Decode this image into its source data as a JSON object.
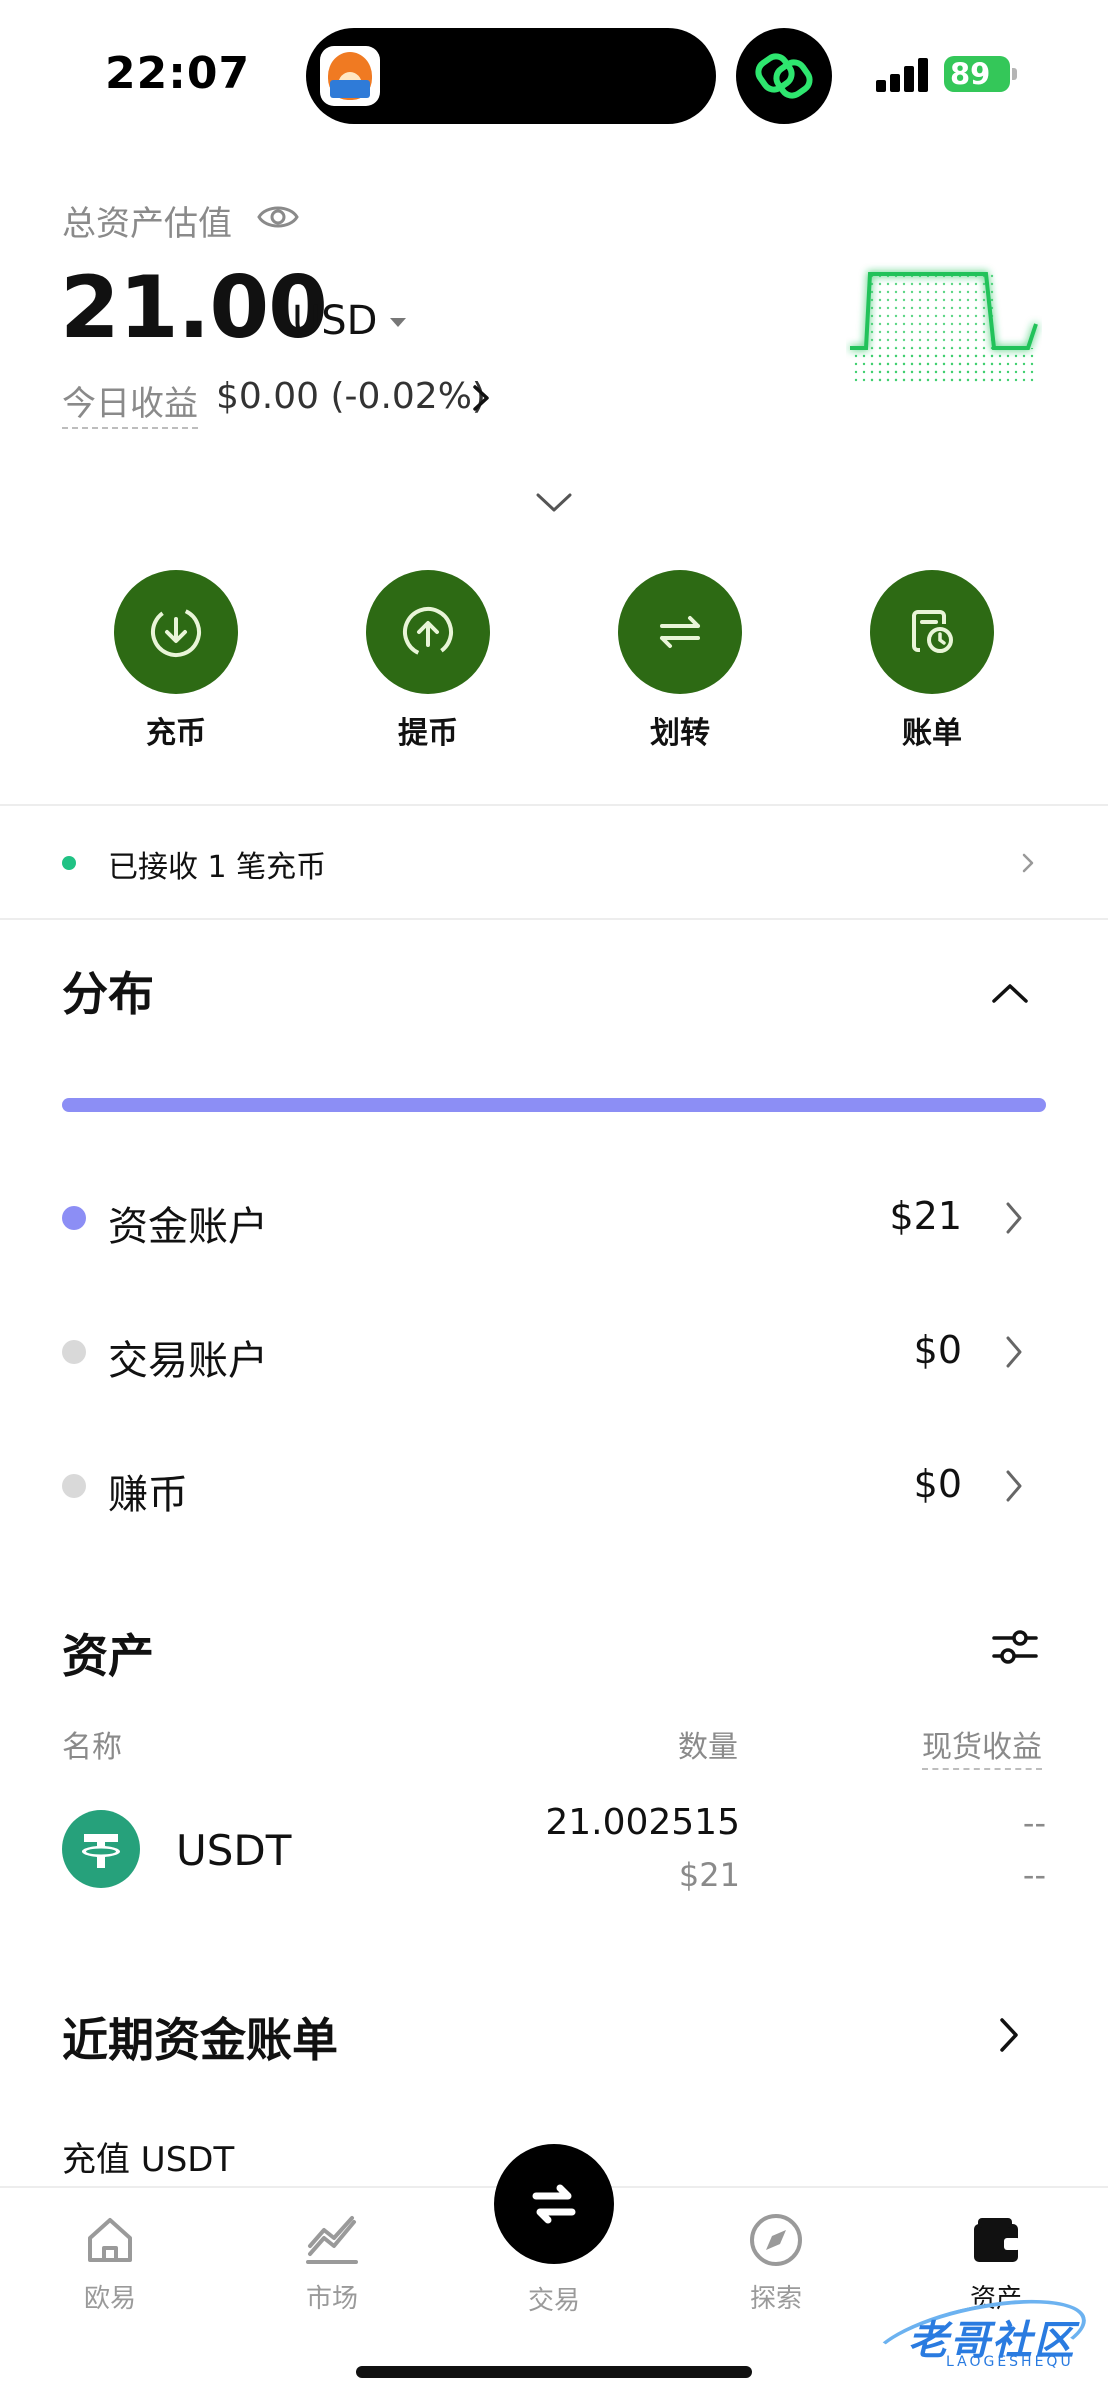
{
  "status_bar": {
    "time": "22:07",
    "battery": "89"
  },
  "header": {
    "total_label": "总资产估值",
    "total_value": "21.00",
    "currency": "USD",
    "today_label": "今日收益",
    "today_value": "$0.00 (-0.02%)"
  },
  "actions": [
    {
      "label": "充币",
      "icon": "deposit-icon"
    },
    {
      "label": "提币",
      "icon": "withdraw-icon"
    },
    {
      "label": "划转",
      "icon": "transfer-icon"
    },
    {
      "label": "账单",
      "icon": "bill-icon"
    }
  ],
  "notice": {
    "text": "已接收 1 笔充币"
  },
  "distribution": {
    "title": "分布",
    "accounts": [
      {
        "name": "资金账户",
        "value": "$21",
        "color": "#8c8ef5"
      },
      {
        "name": "交易账户",
        "value": "$0",
        "color": "#d9d9d9"
      },
      {
        "name": "赚币",
        "value": "$0",
        "color": "#d9d9d9"
      }
    ]
  },
  "assets": {
    "title": "资产",
    "columns": {
      "name": "名称",
      "qty": "数量",
      "spot_pnl": "现货收益"
    },
    "rows": [
      {
        "symbol": "USDT",
        "qty": "21.002515",
        "usd": "$21",
        "pnl": "--",
        "pnl_pct": "--"
      }
    ]
  },
  "recent": {
    "title": "近期资金账单",
    "first_item": "充值 USDT"
  },
  "tabbar": {
    "tabs": [
      {
        "label": "欧易",
        "icon": "home-icon"
      },
      {
        "label": "市场",
        "icon": "market-chart-icon"
      },
      {
        "label": "交易",
        "icon": "swap-icon"
      },
      {
        "label": "探索",
        "icon": "compass-icon"
      },
      {
        "label": "资产",
        "icon": "wallet-icon"
      }
    ],
    "active": "资产"
  },
  "watermark": {
    "text": "老哥社区",
    "sub": "LAOGESHEQU"
  },
  "colors": {
    "action_green": "#2d6a14",
    "dist_accent": "#8c8ef5",
    "usdt": "#26a17b",
    "chart_green": "#20c25a"
  }
}
